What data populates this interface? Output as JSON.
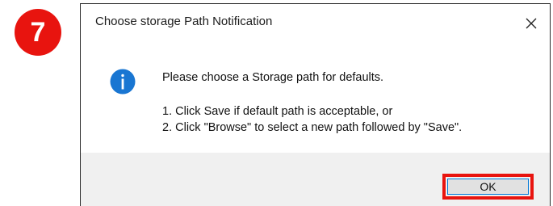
{
  "step_badge": "7",
  "dialog": {
    "title": "Choose storage Path Notification",
    "close_icon": "close-icon",
    "info_icon": "info-icon",
    "main_instruction": "Please choose a Storage path for defaults.",
    "detail_lines": [
      "1. Click Save if default path is acceptable, or",
      "2. Click \"Browse\" to select a new path followed by \"Save\"."
    ],
    "ok_label": "OK"
  },
  "colors": {
    "badge_red": "#e8140f",
    "highlight_red": "#e8140f",
    "info_blue": "#1976d2",
    "footer_gray": "#f0f0f0",
    "button_gray": "#e1e1e1",
    "button_border_blue": "#0078d7"
  }
}
